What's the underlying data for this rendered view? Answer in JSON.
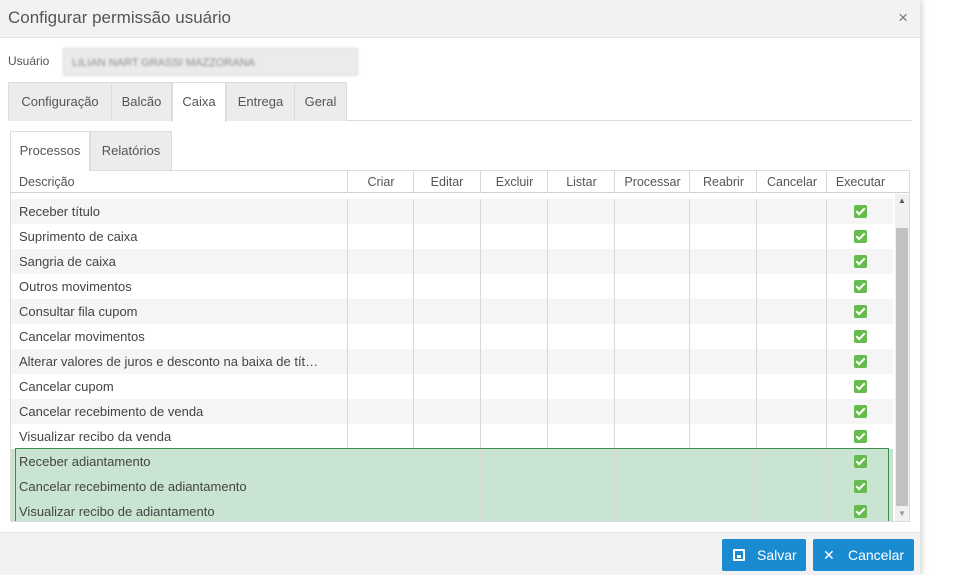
{
  "dialog": {
    "title": "Configurar permissão usuário",
    "close_glyph": "×"
  },
  "user": {
    "label": "Usuário",
    "value": "LILIAN NART GRASSI MAZZORANA"
  },
  "main_tabs": [
    {
      "label": "Configuração",
      "active": false
    },
    {
      "label": "Balcão",
      "active": false
    },
    {
      "label": "Caixa",
      "active": true
    },
    {
      "label": "Entrega",
      "active": false
    },
    {
      "label": "Geral",
      "active": false
    }
  ],
  "sub_tabs": [
    {
      "label": "Processos",
      "active": true
    },
    {
      "label": "Relatórios",
      "active": false
    }
  ],
  "grid": {
    "columns": [
      "Descrição",
      "Criar",
      "Editar",
      "Excluir",
      "Listar",
      "Processar",
      "Reabrir",
      "Cancelar",
      "Executar"
    ],
    "rows": [
      {
        "desc": "Receber título",
        "executar": true,
        "selected": false
      },
      {
        "desc": "Suprimento de caixa",
        "executar": true,
        "selected": false
      },
      {
        "desc": "Sangria de caixa",
        "executar": true,
        "selected": false
      },
      {
        "desc": "Outros movimentos",
        "executar": true,
        "selected": false
      },
      {
        "desc": "Consultar fila cupom",
        "executar": true,
        "selected": false
      },
      {
        "desc": "Cancelar movimentos",
        "executar": true,
        "selected": false
      },
      {
        "desc": "Alterar valores de juros e desconto na baixa de tít…",
        "executar": true,
        "selected": false
      },
      {
        "desc": "Cancelar cupom",
        "executar": true,
        "selected": false
      },
      {
        "desc": "Cancelar recebimento de venda",
        "executar": true,
        "selected": false
      },
      {
        "desc": "Visualizar recibo da venda",
        "executar": true,
        "selected": false
      },
      {
        "desc": "Receber adiantamento",
        "executar": true,
        "selected": true
      },
      {
        "desc": "Cancelar recebimento de adiantamento",
        "executar": true,
        "selected": true
      },
      {
        "desc": "Visualizar recibo de adiantamento",
        "executar": true,
        "selected": true
      }
    ]
  },
  "footer": {
    "save_label": "Salvar",
    "cancel_label": "Cancelar",
    "cancel_glyph": "✕"
  },
  "colors": {
    "primary_button": "#1a8bd1",
    "checkbox_green": "#66bb4f",
    "selection_bg": "#c9e5d2",
    "selection_border": "#3f8c4f"
  }
}
